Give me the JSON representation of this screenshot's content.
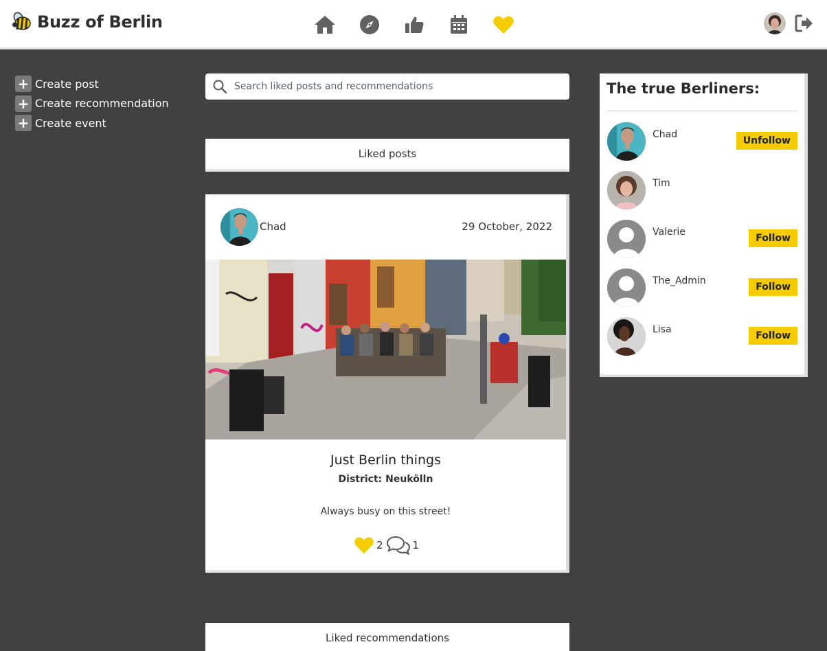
{
  "brand": {
    "name": "Buzz of Berlin"
  },
  "nav": {
    "icons": [
      "home-icon",
      "compass-icon",
      "thumbs-up-icon",
      "calendar-icon",
      "heart-icon"
    ],
    "active_color": "#f5cc00",
    "icon_color": "#616161"
  },
  "sidebar": {
    "items": [
      {
        "label": "Create post"
      },
      {
        "label": "Create recommendation"
      },
      {
        "label": "Create event"
      }
    ]
  },
  "search": {
    "placeholder": "Search liked posts and recommendations"
  },
  "sections": {
    "liked_posts": "Liked posts",
    "liked_recommendations": "Liked recommendations"
  },
  "post": {
    "author": "Chad",
    "date": "29 October, 2022",
    "title": "Just Berlin things",
    "district": "District: Neukölln",
    "body": "Always busy on this street!",
    "likes": "2",
    "comments": "1"
  },
  "berliners": {
    "title": "The true Berliners:",
    "users": [
      {
        "name": "Chad",
        "button": "Unfollow"
      },
      {
        "name": "Tim",
        "button": ""
      },
      {
        "name": "Valerie",
        "button": "Follow"
      },
      {
        "name": "The_Admin",
        "button": "Follow"
      },
      {
        "name": "Lisa",
        "button": "Follow"
      }
    ]
  },
  "colors": {
    "accent": "#f5cc00",
    "background": "#414141"
  }
}
